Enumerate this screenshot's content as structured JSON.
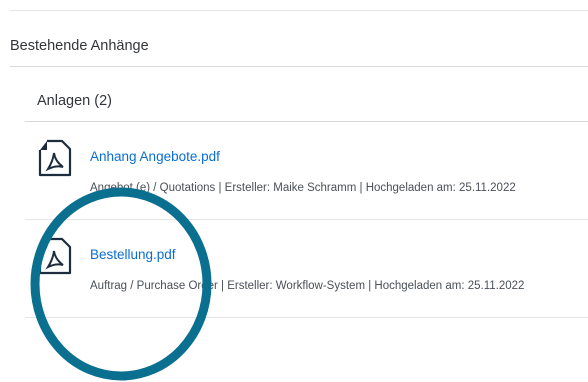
{
  "section": {
    "title": "Bestehende Anhänge"
  },
  "attachments": {
    "header": "Anlagen (2)",
    "items": [
      {
        "name": "Anhang Angebote.pdf",
        "meta": "Angebot (e) / Quotations | Ersteller: Maike Schramm | Hochgeladen am: 25.11.2022",
        "icon": "pdf-file-icon"
      },
      {
        "name": "Bestellung.pdf",
        "meta": "Auftrag / Purchase Order | Ersteller: Workflow-System | Hochgeladen am: 25.11.2022",
        "icon": "pdf-file-icon"
      }
    ]
  },
  "colors": {
    "link": "#0a6ed1",
    "icon": "#1d2d3e",
    "annotation": "#0b6f8f"
  }
}
